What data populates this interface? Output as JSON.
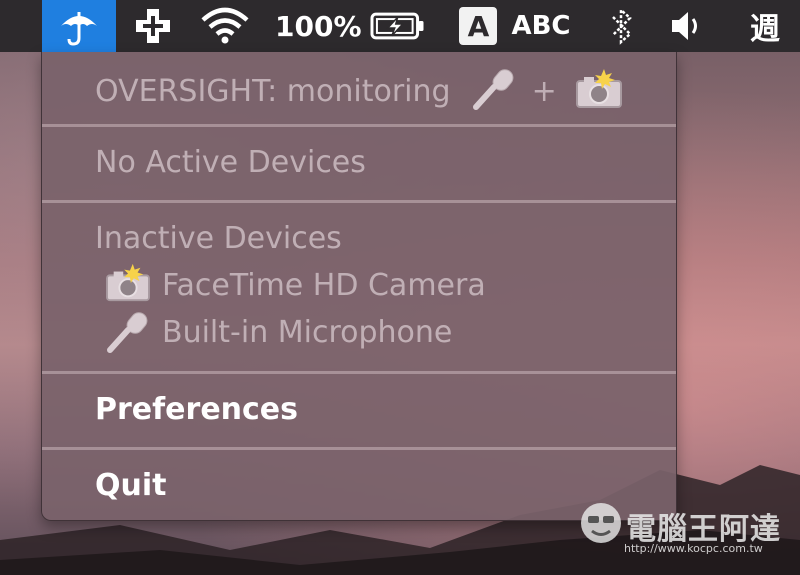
{
  "menubar": {
    "battery_percent": "100%",
    "input_badge": "A",
    "input_source": "ABC",
    "clock_fragment": "週",
    "icons": [
      "umbrella-icon",
      "first-aid-cross-icon",
      "wifi-icon",
      "battery-charging-icon",
      "bluetooth-icon",
      "volume-icon"
    ]
  },
  "menu": {
    "status_text": "OVERSIGHT: monitoring",
    "status_joiner": "+",
    "active_heading": "No Active Devices",
    "inactive_heading": "Inactive Devices",
    "inactive_devices": [
      {
        "label": "FaceTime HD Camera",
        "icon": "camera-icon"
      },
      {
        "label": "Built-in Microphone",
        "icon": "microphone-icon"
      }
    ],
    "preferences_label": "Preferences",
    "quit_label": "Quit"
  },
  "watermark": {
    "title": "電腦王阿達",
    "url": "http://www.kocpc.com.tw"
  }
}
